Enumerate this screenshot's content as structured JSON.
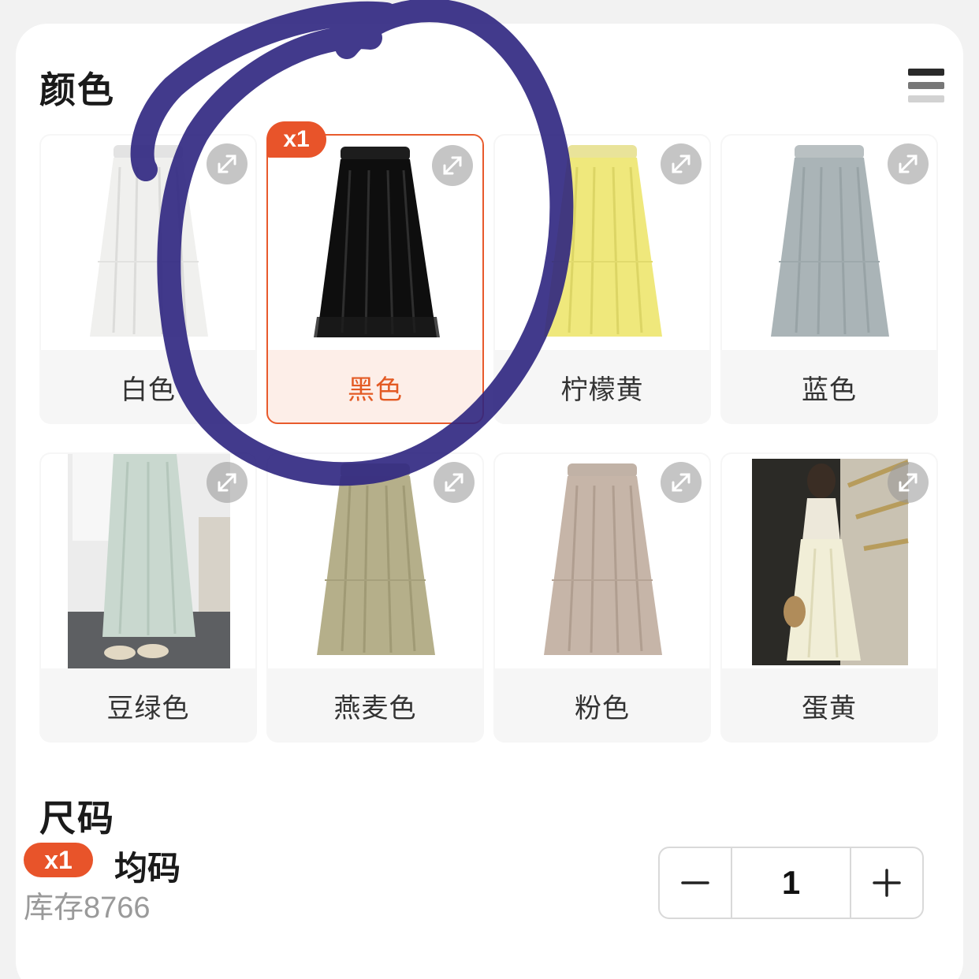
{
  "color_section": {
    "title": "颜色",
    "options": [
      {
        "label": "白色",
        "selected": false
      },
      {
        "label": "黑色",
        "selected": true,
        "badge": "x1"
      },
      {
        "label": "柠檬黄",
        "selected": false
      },
      {
        "label": "蓝色",
        "selected": false
      },
      {
        "label": "豆绿色",
        "selected": false
      },
      {
        "label": "燕麦色",
        "selected": false
      },
      {
        "label": "粉色",
        "selected": false
      },
      {
        "label": "蛋黄",
        "selected": false
      }
    ]
  },
  "size_section": {
    "title": "尺码",
    "item": {
      "badge": "x1",
      "name": "均码",
      "stock_label": "库存",
      "stock_value": "8766"
    },
    "quantity": "1"
  },
  "colors": {
    "accent": "#e8542a",
    "selected_bg": "#fdeee8",
    "annotation": "#2e2580"
  }
}
